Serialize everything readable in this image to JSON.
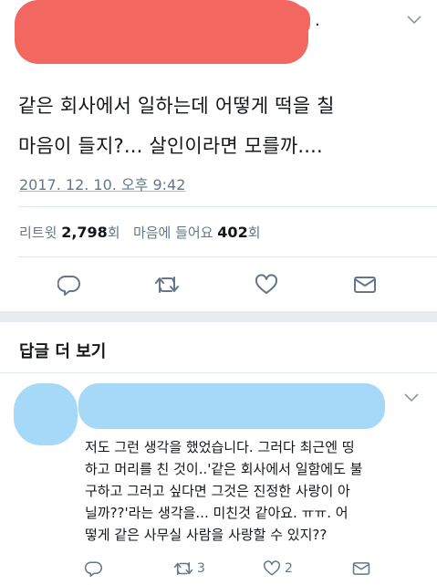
{
  "tweet": {
    "text_lines": [
      "같은 회사에서 일하는데 어떻게 떡을 칠",
      "마음이 들지?... 살인이라면 모를까...."
    ],
    "timestamp": "2017. 12. 10. 오후 9:42",
    "retweet_label": "리트윗",
    "retweet_count": "2,798",
    "retweet_unit": "회",
    "like_label": "마음에 들어요",
    "like_count": "402",
    "like_unit": "회",
    "header_trailing_dot": "."
  },
  "actions": {
    "icons": [
      "reply-icon",
      "retweet-icon",
      "like-icon",
      "message-icon"
    ]
  },
  "more_replies": {
    "title": "답글 더 보기"
  },
  "reply": {
    "text_lines": [
      "저도 그런 생각을 했었습니다. 그러다 최근엔 띵",
      "하고 머리를 친 것이..'같은 회사에서 일함에도 불",
      "구하고 그러고 싶다면 그것은 진정한 사랑이 아",
      "닐까??'라는 생각을... 미친것 같아요. ㅠㅠ.  어",
      "떻게 같은 사무실 사람을 사랑할 수 있지??"
    ],
    "retweet_count": "3",
    "like_count": "2"
  },
  "colors": {
    "redaction_red": "#f2675f",
    "redaction_blue": "#a6d8f7",
    "secondary_text": "#657786",
    "icon_gray": "#657786",
    "divider": "#e1e8ed"
  }
}
